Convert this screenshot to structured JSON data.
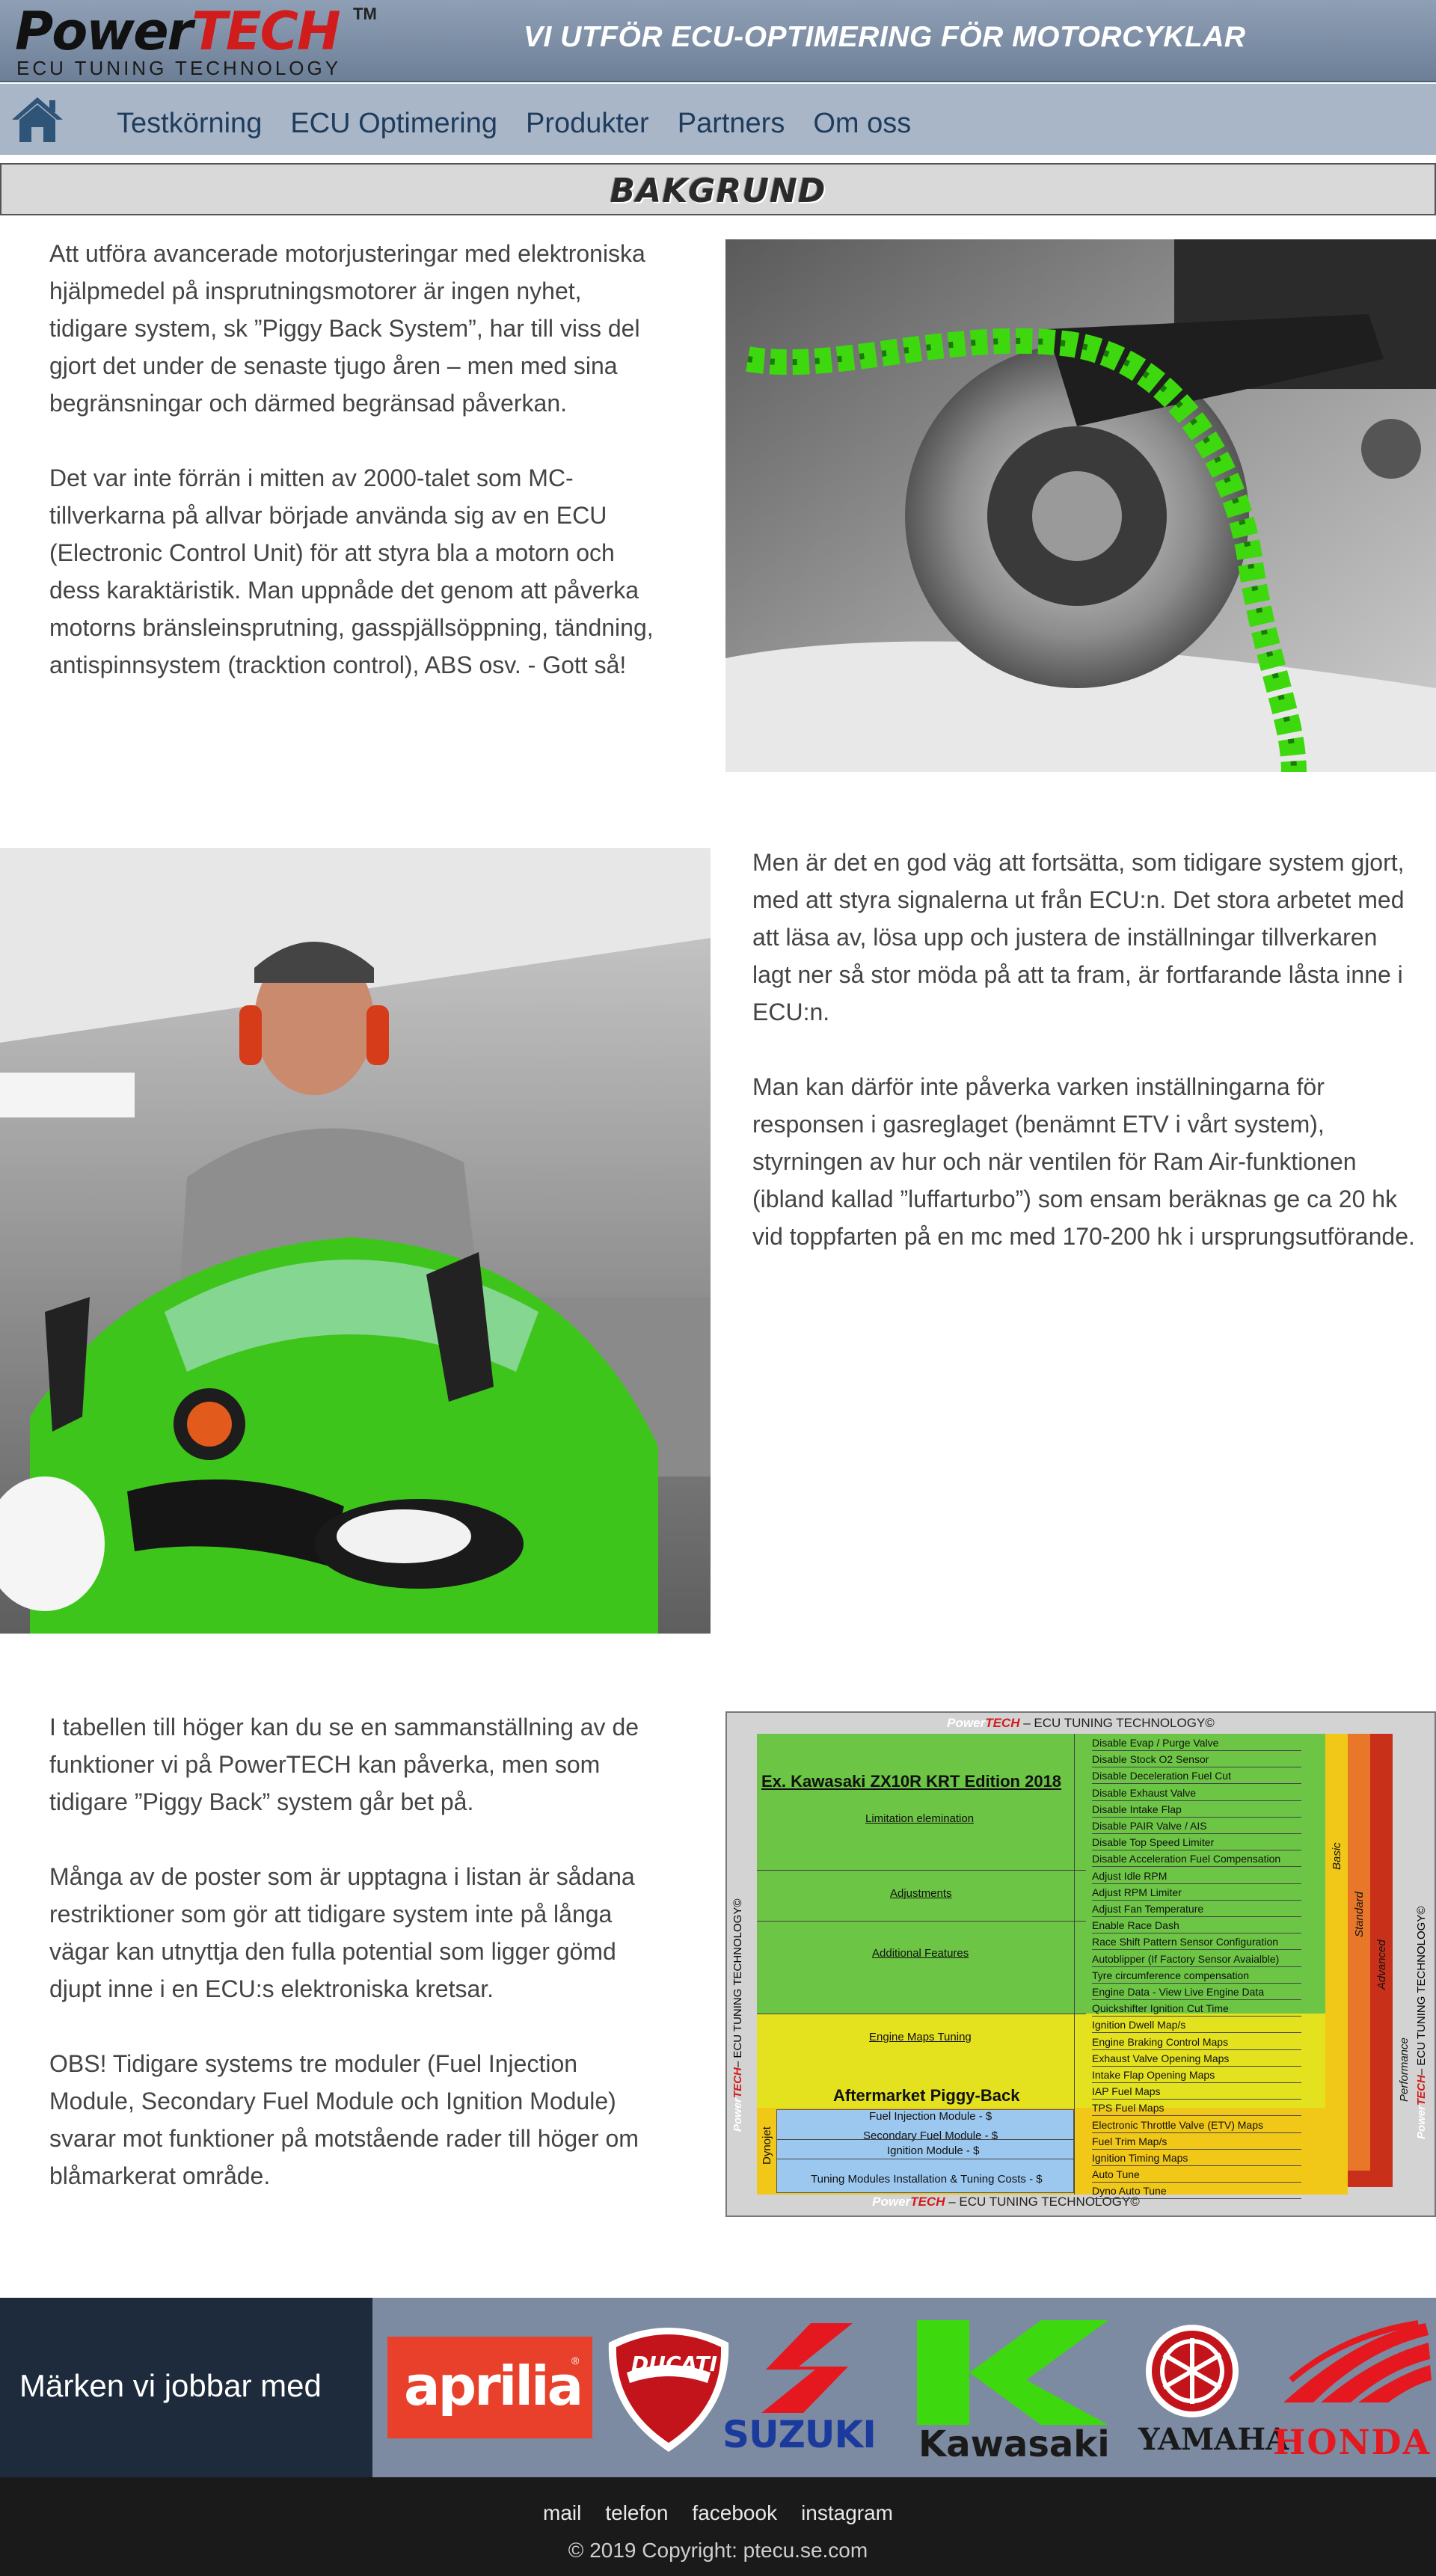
{
  "header": {
    "logo_power": "Power",
    "logo_tech": "TECH",
    "logo_tm": "TM",
    "logo_sub": "ECU TUNING TECHNOLOGY",
    "tagline": "VI UTFÖR ECU-OPTIMERING FÖR MOTORCYKLAR"
  },
  "nav": {
    "home_icon": "home-icon",
    "items": [
      "Testkörning",
      "ECU Optimering",
      "Produkter",
      "Partners",
      "Om oss"
    ]
  },
  "section": {
    "title": "BAKGRUND"
  },
  "block1": {
    "p1": "Att utföra avancerade motorjusteringar med elektroniska hjälpmedel på insprutningsmotorer är ingen nyhet, tidigare system, sk ”Piggy Back System”, har till viss del gjort det under de senaste tjugo åren – men med sina begränsningar och därmed begränsad påverkan.",
    "p2": "Det var inte förrän i mitten av 2000-talet som MC-tillverkarna på allvar började använda sig av en ECU (Electronic Control Unit) för att styra bla a motorn och dess karaktäristik. Man uppnåde det genom att påverka motorns bränsleinsprutning, gasspjällsöppning, tändning, antispinnsystem (tracktion control), ABS osv. - Gott så!"
  },
  "block2": {
    "p1": "Men är det en god väg att fortsätta, som tidigare system gjort, med att styra signalerna ut från ECU:n. Det stora arbetet med att läsa av, lösa upp och justera de inställningar tillverkaren lagt ner så stor möda på att ta fram, är fortfarande låsta inne i ECU:n.",
    "p2": "Man kan därför inte påverka varken inställningarna för responsen i gasreglaget (benämnt ETV i vårt system), styrningen av hur och när ventilen för Ram Air-funktionen (ibland kallad ”luffarturbo”) som ensam beräknas ge ca 20 hk vid toppfarten på en mc med 170-200 hk i ursprungsutförande."
  },
  "block3": {
    "p1": "I tabellen till höger kan du se en sammanställning av de funktioner vi på PowerTECH kan påverka, men som tidigare ”Piggy Back” system går bet på.",
    "p2": "Många av de poster som är upptagna i listan är sådana restriktioner som gör att tidigare system inte på långa vägar kan utnyttja den fulla potential som ligger gömd djupt inne i en ECU:s elektroniska kretsar.",
    "p3": "OBS! Tidigare systems tre moduler (Fuel Injection Module, Secondary Fuel Module och Ignition Module) svarar mot funktioner på motstående rader till höger om blåmarkerat område."
  },
  "table": {
    "header_power": "Power",
    "header_tech": "TECH",
    "header_rest": " – ECU TUNING TECHNOLOGY©",
    "side_label": "– ECU TUNING TECHNOLOGY©",
    "model": "Ex. Kawasaki ZX10R KRT Edition 2018",
    "groups": [
      "Limitation elemination",
      "Adjustments",
      "Additional Features",
      "Engine Maps Tuning"
    ],
    "piggy_title": "Aftermarket Piggy-Back",
    "piggy_rows": [
      "Fuel Injection Module - $",
      "Secondary Fuel Module - $",
      "Ignition Module - $",
      "Tuning Modules Installation & Tuning Costs  - $"
    ],
    "dynojet": "Dynojet",
    "tiers": [
      "Basic",
      "Standard",
      "Advanced",
      "Performance"
    ],
    "features": [
      "Disable Evap / Purge Valve",
      "Disable Stock O2 Sensor",
      "Disable Deceleration Fuel Cut",
      "Disable Exhaust Valve",
      "Disable Intake Flap",
      "Disable PAIR Valve / AIS",
      "Disable Top Speed Limiter",
      "Disable Acceleration Fuel Compensation",
      "Adjust Idle RPM",
      "Adjust RPM Limiter",
      "Adjust Fan Temperature",
      "Enable Race Dash",
      "Race Shift Pattern Sensor Configuration",
      "Autoblipper (If Factory Sensor Avaialble)",
      "Tyre circumference compensation",
      "Engine Data - View Live Engine Data",
      "Quickshifter Ignition Cut Time",
      "Ignition Dwell Map/s",
      "Engine Braking Control Maps",
      "Exhaust Valve Opening Maps",
      "Intake Flap Opening Maps",
      "IAP Fuel Maps",
      "TPS Fuel Maps",
      "Electronic Throttle Valve (ETV) Maps",
      "Fuel Trim Map/s",
      "Ignition Timing Maps",
      "Auto Tune",
      "Dyno Auto Tune"
    ]
  },
  "brands": {
    "label": "Märken vi jobbar med",
    "logos": [
      "aprilia",
      "DUCATI",
      "SUZUKI",
      "Kawasaki",
      "YAMAHA",
      "HONDA"
    ],
    "aprilia_mark": "®"
  },
  "footer": {
    "links": [
      "mail",
      "telefon",
      "facebook",
      "instagram"
    ],
    "copyright": "© 2019 Copyright: ptecu.se.com"
  },
  "colors": {
    "header": "#7c8ea6",
    "nav": "#a8b6c8",
    "green": "#6cc544",
    "yellow": "#e4e21e",
    "blue": "#9cc8f0"
  }
}
